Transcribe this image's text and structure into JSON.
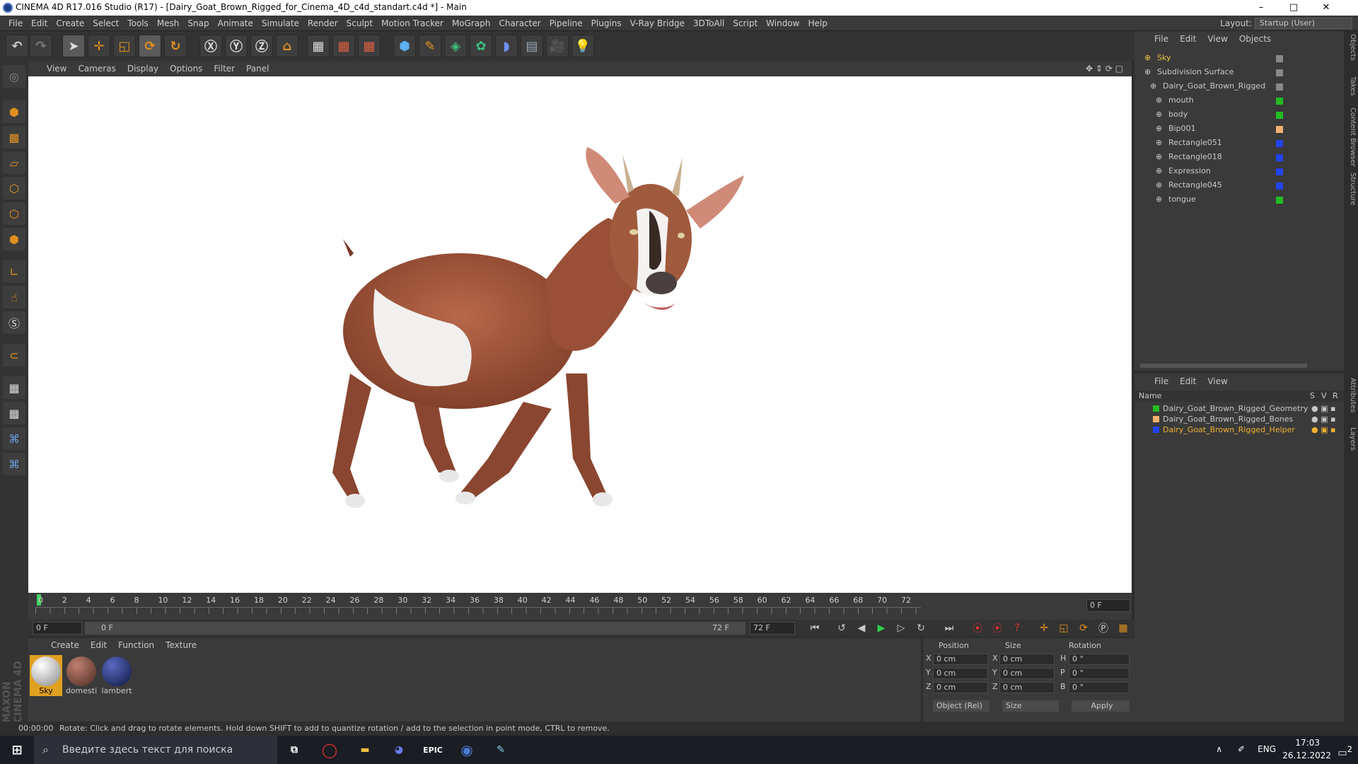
{
  "window": {
    "title": "CINEMA 4D R17.016 Studio (R17) - [Dairy_Goat_Brown_Rigged_for_Cinema_4D_c4d_standart.c4d *] - Main",
    "minimize": "–",
    "maximize": "□",
    "close": "✕"
  },
  "menu": [
    "File",
    "Edit",
    "Create",
    "Select",
    "Tools",
    "Mesh",
    "Snap",
    "Animate",
    "Simulate",
    "Render",
    "Sculpt",
    "Motion Tracker",
    "MoGraph",
    "Character",
    "Pipeline",
    "Plugins",
    "V-Ray Bridge",
    "3DToAll",
    "Script",
    "Window",
    "Help"
  ],
  "layout": {
    "label": "Layout:",
    "value": "Startup (User)"
  },
  "viewport_menu": [
    "View",
    "Cameras",
    "Display",
    "Options",
    "Filter",
    "Panel"
  ],
  "timeline": {
    "ticks": [
      "0",
      "2",
      "4",
      "6",
      "8",
      "10",
      "12",
      "14",
      "16",
      "18",
      "20",
      "22",
      "24",
      "26",
      "28",
      "30",
      "32",
      "34",
      "36",
      "38",
      "40",
      "42",
      "44",
      "46",
      "48",
      "50",
      "52",
      "54",
      "56",
      "58",
      "60",
      "62",
      "64",
      "66",
      "68",
      "70",
      "72"
    ],
    "current_frame": "0 F"
  },
  "transport": {
    "start": "0 F",
    "range_start": "0 F",
    "range_end": "72 F",
    "end": "72 F"
  },
  "material_menu": [
    "Create",
    "Edit",
    "Function",
    "Texture"
  ],
  "materials": [
    {
      "name": "Sky",
      "color": "#e8e8e8"
    },
    {
      "name": "domesti",
      "color": "#7a4a3a"
    },
    {
      "name": "lambert",
      "color": "#1c2a6a"
    }
  ],
  "coords": {
    "headers": [
      "Position",
      "Size",
      "Rotation"
    ],
    "rows": [
      {
        "axis": "X",
        "pos": "0 cm",
        "saxis": "X",
        "size": "0 cm",
        "raxis": "H",
        "rot": "0 °"
      },
      {
        "axis": "Y",
        "pos": "0 cm",
        "saxis": "Y",
        "size": "0 cm",
        "raxis": "P",
        "rot": "0 °"
      },
      {
        "axis": "Z",
        "pos": "0 cm",
        "saxis": "Z",
        "size": "0 cm",
        "raxis": "B",
        "rot": "0 °"
      }
    ],
    "mode": "Object (Rel)",
    "size_mode": "Size",
    "apply": "Apply"
  },
  "object_manager": {
    "menu": [
      "File",
      "Edit",
      "View",
      "Objects"
    ],
    "objects": [
      {
        "name": "Sky",
        "color": "#888888",
        "highlight": true
      },
      {
        "name": "Subdivision Surface",
        "color": "#888888"
      },
      {
        "name": "Dairy_Goat_Brown_Rigged",
        "color": "#888888"
      },
      {
        "name": "mouth",
        "color": "#22bb22"
      },
      {
        "name": "body",
        "color": "#22bb22"
      },
      {
        "name": "Bip001",
        "color": "#f0b070"
      },
      {
        "name": "Rectangle051",
        "color": "#2244ee"
      },
      {
        "name": "Rectangle018",
        "color": "#2244ee"
      },
      {
        "name": "Expression",
        "color": "#2244ee"
      },
      {
        "name": "Rectangle045",
        "color": "#2244ee"
      },
      {
        "name": "tongue",
        "color": "#22bb22"
      }
    ]
  },
  "layer_manager": {
    "menu": [
      "File",
      "Edit",
      "View"
    ],
    "columns": [
      "Name",
      "S",
      "V",
      "R"
    ],
    "layers": [
      {
        "name": "Dairy_Goat_Brown_Rigged_Geometry",
        "color": "#22bb22"
      },
      {
        "name": "Dairy_Goat_Brown_Rigged_Bones",
        "color": "#f0b070"
      },
      {
        "name": "Dairy_Goat_Brown_Rigged_Helper",
        "color": "#2244ee",
        "highlight": true
      }
    ]
  },
  "side_tabs": [
    "Objects",
    "Takes",
    "Content Browser",
    "Structure",
    "Attributes",
    "Layers"
  ],
  "status": {
    "time": "00:00:00",
    "message": "Rotate: Click and drag to rotate elements. Hold down SHIFT to add to quantize rotation / add to the selection in point mode, CTRL to remove."
  },
  "brand": {
    "line1": "MAXON",
    "line2": "CINEMA 4D"
  },
  "taskbar": {
    "search_placeholder": "Введите здесь текст для поиска",
    "lang": "ENG",
    "time": "17:03",
    "date": "26.12.2022",
    "notif": "2"
  }
}
